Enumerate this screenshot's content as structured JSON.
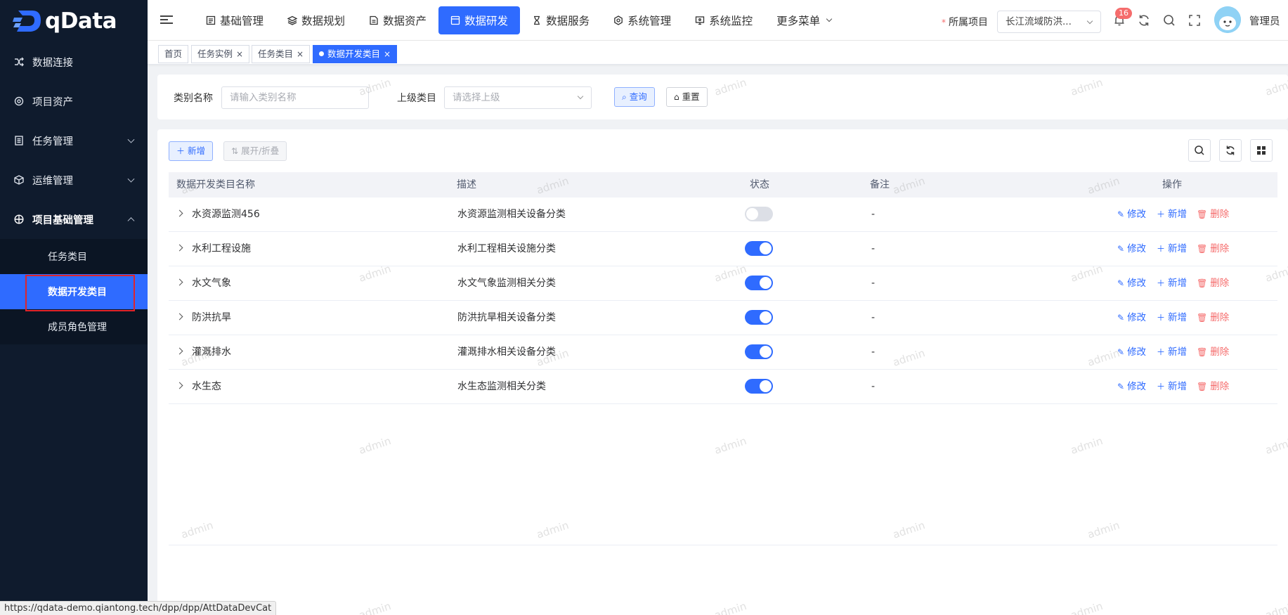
{
  "app": {
    "logo_text": "qData"
  },
  "sidebar": {
    "items": [
      {
        "label": "数据连接",
        "icon": "shuffle-icon",
        "has_children": false
      },
      {
        "label": "项目资产",
        "icon": "asset-icon",
        "has_children": false
      },
      {
        "label": "任务管理",
        "icon": "list-icon",
        "has_children": true
      },
      {
        "label": "运维管理",
        "icon": "cube-icon",
        "has_children": true
      },
      {
        "label": "项目基础管理",
        "icon": "globe-icon",
        "has_children": true,
        "expanded": true
      }
    ],
    "subitems": [
      {
        "label": "任务类目",
        "active": false
      },
      {
        "label": "数据开发类目",
        "active": true
      },
      {
        "label": "成员角色管理",
        "active": false
      }
    ]
  },
  "topnav": {
    "items": [
      {
        "label": "基础管理",
        "icon": "grid-icon"
      },
      {
        "label": "数据规划",
        "icon": "layers-icon"
      },
      {
        "label": "数据资产",
        "icon": "file-icon"
      },
      {
        "label": "数据研发",
        "icon": "window-icon",
        "active": true
      },
      {
        "label": "数据服务",
        "icon": "hourglass-icon"
      },
      {
        "label": "系统管理",
        "icon": "settings-icon"
      },
      {
        "label": "系统监控",
        "icon": "monitor-icon"
      }
    ],
    "more_label": "更多菜单",
    "project_label": "所属项目",
    "project_value": "长江流域防洪...",
    "notification_count": "16",
    "user_name": "管理员"
  },
  "tags": [
    {
      "label": "首页",
      "closable": false,
      "active": false
    },
    {
      "label": "任务实例",
      "closable": true,
      "active": false
    },
    {
      "label": "任务类目",
      "closable": true,
      "active": false
    },
    {
      "label": "数据开发类目",
      "closable": true,
      "active": true
    }
  ],
  "query": {
    "name_label": "类别名称",
    "name_placeholder": "请输入类别名称",
    "parent_label": "上级类目",
    "parent_placeholder": "请选择上级",
    "search_label": "查询",
    "reset_label": "重置"
  },
  "toolbar": {
    "add_label": "新增",
    "toggle_label": "展开/折叠"
  },
  "table": {
    "columns": [
      "数据开发类目名称",
      "描述",
      "状态",
      "备注",
      "操作"
    ],
    "rows": [
      {
        "name": "水资源监测456",
        "desc": "水资源监测相关设备分类",
        "enabled": false,
        "remark": "-"
      },
      {
        "name": "水利工程设施",
        "desc": "水利工程相关设施分类",
        "enabled": true,
        "remark": "-"
      },
      {
        "name": "水文气象",
        "desc": "水文气象监测相关分类",
        "enabled": true,
        "remark": "-"
      },
      {
        "name": "防洪抗旱",
        "desc": "防洪抗旱相关设备分类",
        "enabled": true,
        "remark": "-"
      },
      {
        "name": "灌溉排水",
        "desc": "灌溉排水相关设备分类",
        "enabled": true,
        "remark": "-"
      },
      {
        "name": "水生态",
        "desc": "水生态监测相关分类",
        "enabled": true,
        "remark": "-"
      }
    ],
    "actions": {
      "edit": "修改",
      "add": "新增",
      "delete": "删除"
    }
  },
  "watermark_text": "admin",
  "status_url": "https://qdata-demo.qiantong.tech/dpp/dpp/AttDataDevCat",
  "colors": {
    "primary": "#2f6bff",
    "sidebar_bg": "#0f1b2d",
    "danger": "#f56c6c",
    "highlight_border": "#e0242b"
  }
}
